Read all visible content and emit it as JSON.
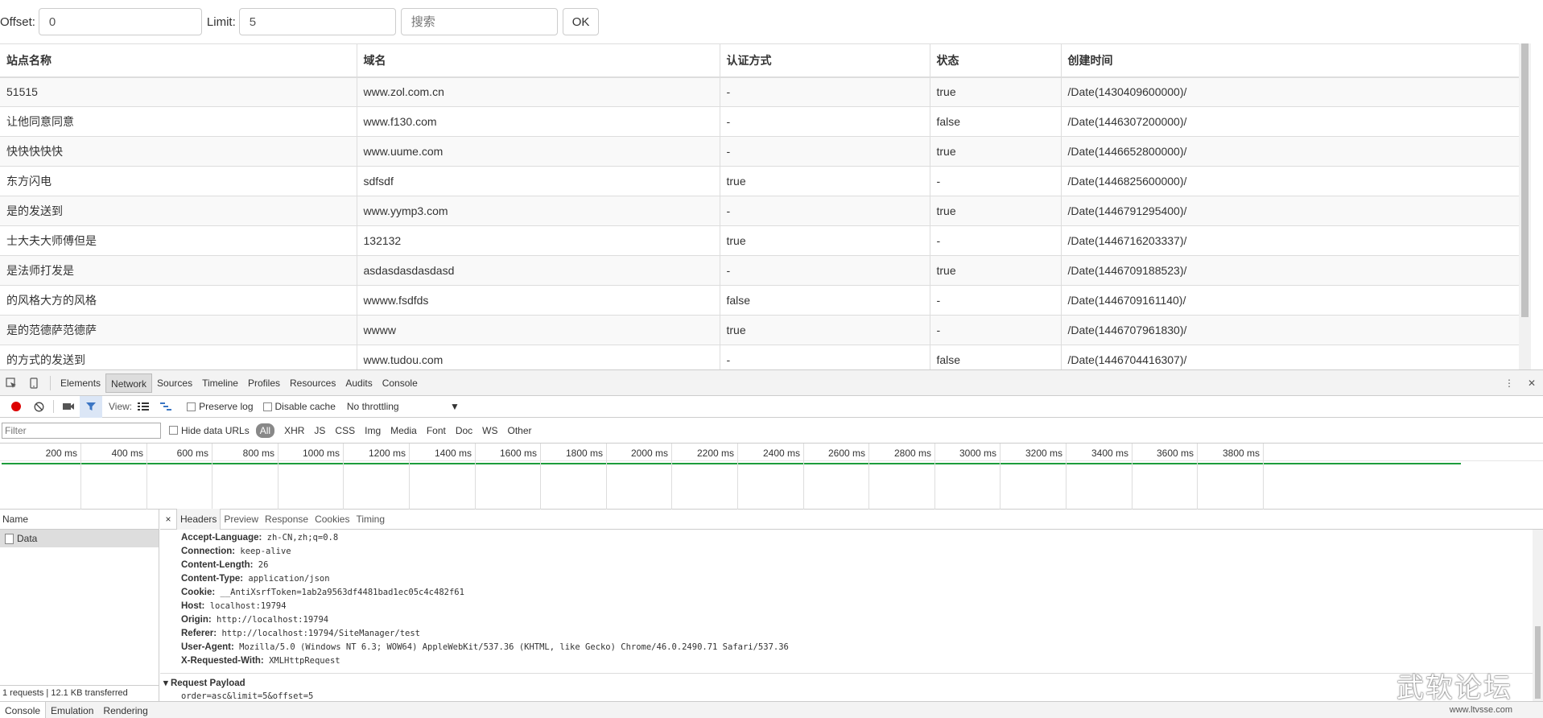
{
  "form": {
    "offset_label": "Offset:",
    "offset_value": "0",
    "limit_label": "Limit:",
    "limit_value": "5",
    "search_placeholder": "搜索",
    "ok_label": "OK"
  },
  "table": {
    "columns": [
      "站点名称",
      "域名",
      "认证方式",
      "状态",
      "创建时间"
    ],
    "rows": [
      [
        "51515",
        "www.zol.com.cn",
        "-",
        "true",
        "/Date(1430409600000)/"
      ],
      [
        "让他同意同意",
        "www.f130.com",
        "-",
        "false",
        "/Date(1446307200000)/"
      ],
      [
        "快快快快快",
        "www.uume.com",
        "-",
        "true",
        "/Date(1446652800000)/"
      ],
      [
        "东方闪电",
        "sdfsdf",
        "true",
        "-",
        "/Date(1446825600000)/"
      ],
      [
        "是的发送到",
        "www.yymp3.com",
        "-",
        "true",
        "/Date(1446791295400)/"
      ],
      [
        "士大夫大师傅但是",
        "132132",
        "true",
        "-",
        "/Date(1446716203337)/"
      ],
      [
        "是法师打发是",
        "asdasdasdasdasd",
        "-",
        "true",
        "/Date(1446709188523)/"
      ],
      [
        "的风格大方的风格",
        "wwww.fsdfds",
        "false",
        "-",
        "/Date(1446709161140)/"
      ],
      [
        "是的范德萨范德萨",
        "wwww",
        "true",
        "-",
        "/Date(1446707961830)/"
      ],
      [
        "的方式的发送到",
        "www.tudou.com",
        "-",
        "false",
        "/Date(1446704416307)/"
      ]
    ]
  },
  "devtools": {
    "tabs": [
      "Elements",
      "Network",
      "Sources",
      "Timeline",
      "Profiles",
      "Resources",
      "Audits",
      "Console"
    ],
    "active_tab": "Network",
    "toolbar": {
      "view_label": "View:",
      "preserve_log": "Preserve log",
      "disable_cache": "Disable cache",
      "throttling": "No throttling"
    },
    "filter": {
      "placeholder": "Filter",
      "hide_data_urls": "Hide data URLs",
      "types": [
        "All",
        "XHR",
        "JS",
        "CSS",
        "Img",
        "Media",
        "Font",
        "Doc",
        "WS",
        "Other"
      ]
    },
    "timeline_ticks": [
      "200 ms",
      "400 ms",
      "600 ms",
      "800 ms",
      "1000 ms",
      "1200 ms",
      "1400 ms",
      "1600 ms",
      "1800 ms",
      "2000 ms",
      "2200 ms",
      "2400 ms",
      "2600 ms",
      "2800 ms",
      "3000 ms",
      "3200 ms",
      "3400 ms",
      "3600 ms",
      "3800 ms"
    ],
    "name_header": "Name",
    "request_name": "Data",
    "status": "1 requests | 12.1 KB transferred",
    "detail_tabs": [
      "Headers",
      "Preview",
      "Response",
      "Cookies",
      "Timing"
    ],
    "headers": [
      {
        "k": "Accept-Language:",
        "v": "zh-CN,zh;q=0.8"
      },
      {
        "k": "Connection:",
        "v": "keep-alive"
      },
      {
        "k": "Content-Length:",
        "v": "26"
      },
      {
        "k": "Content-Type:",
        "v": "application/json"
      },
      {
        "k": "Cookie:",
        "v": "__AntiXsrfToken=1ab2a9563df4481bad1ec05c4c482f61"
      },
      {
        "k": "Host:",
        "v": "localhost:19794"
      },
      {
        "k": "Origin:",
        "v": "http://localhost:19794"
      },
      {
        "k": "Referer:",
        "v": "http://localhost:19794/SiteManager/test"
      },
      {
        "k": "User-Agent:",
        "v": "Mozilla/5.0 (Windows NT 6.3; WOW64) AppleWebKit/537.36 (KHTML, like Gecko) Chrome/46.0.2490.71 Safari/537.36"
      },
      {
        "k": "X-Requested-With:",
        "v": "XMLHttpRequest"
      }
    ],
    "payload_title": "Request Payload",
    "payload_value": "order=asc&limit=5&offset=5",
    "bottom_tabs": [
      "Console",
      "Emulation",
      "Rendering"
    ]
  },
  "watermark": {
    "big": "武软论坛",
    "small": "www.ltvsse.com"
  }
}
